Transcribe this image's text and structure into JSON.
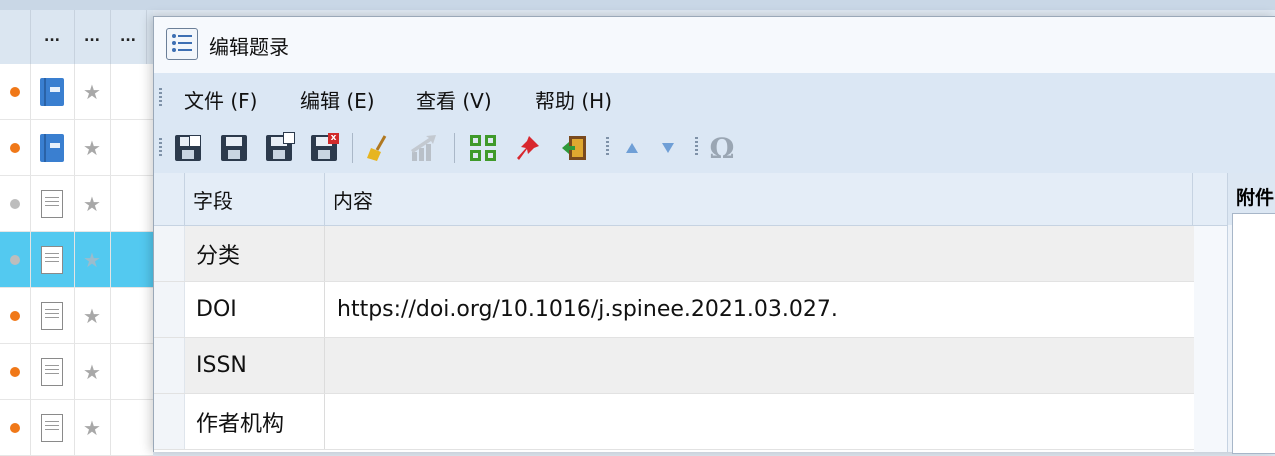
{
  "background_list": {
    "header_cells": [
      "...",
      "...",
      "..."
    ],
    "rows": [
      {
        "status": "orange",
        "icon": "book-icon",
        "selected": false
      },
      {
        "status": "orange",
        "icon": "book-icon",
        "selected": false
      },
      {
        "status": "gray",
        "icon": "document-icon",
        "selected": false
      },
      {
        "status": "gray",
        "icon": "document-icon",
        "selected": true
      },
      {
        "status": "orange",
        "icon": "document-icon",
        "selected": false
      },
      {
        "status": "orange",
        "icon": "document-icon",
        "selected": false
      },
      {
        "status": "orange",
        "icon": "document-icon",
        "selected": false
      }
    ]
  },
  "dialog": {
    "title": "编辑题录",
    "menu": [
      "文件 (F)",
      "编辑 (E)",
      "查看 (V)",
      "帮助 (H)"
    ],
    "toolbar": [
      "save-add-icon",
      "save-icon",
      "save-copy-icon",
      "save-delete-icon",
      "broom-icon",
      "chart-icon",
      "grid-icon",
      "pin-icon",
      "exit-icon",
      "arrow-up-icon",
      "arrow-down-icon",
      "omega-icon"
    ],
    "grid": {
      "headers": {
        "field": "字段",
        "value": "内容"
      },
      "rows": [
        {
          "field": "分类",
          "value": ""
        },
        {
          "field": "DOI",
          "value": "https://doi.org/10.1016/j.spinee.2021.03.027."
        },
        {
          "field": "ISSN",
          "value": ""
        },
        {
          "field": "作者机构",
          "value": ""
        }
      ]
    },
    "side_panel_title": "附件"
  },
  "colors": {
    "accent_selected": "#53c9f0",
    "status_orange": "#f07818",
    "status_gray": "#bdbdbd",
    "toolbar_bg": "#dbe7f4"
  }
}
